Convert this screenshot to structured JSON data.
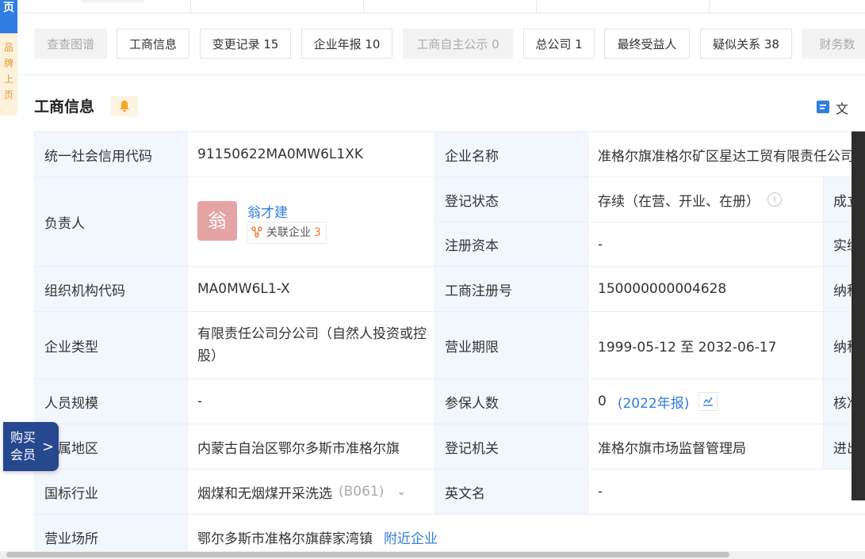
{
  "side_tab": {
    "cap": "页",
    "vertical_text": "品牌上页"
  },
  "filters": [
    {
      "label": "查查图谱",
      "disabled": true
    },
    {
      "label": "工商信息",
      "disabled": false
    },
    {
      "label": "变更记录 15",
      "disabled": false
    },
    {
      "label": "企业年报 10",
      "disabled": false
    },
    {
      "label": "工商自主公示 0",
      "disabled": true
    },
    {
      "label": "总公司 1",
      "disabled": false
    },
    {
      "label": "最终受益人",
      "disabled": false
    },
    {
      "label": "疑似关系 38",
      "disabled": false
    },
    {
      "label": "财务数",
      "disabled": true
    }
  ],
  "section": {
    "title": "工商信息",
    "doc_link": "文"
  },
  "labels": {
    "credit_code": "统一社会信用代码",
    "company_name": "企业名称",
    "legal_person": "负责人",
    "reg_status": "登记状态",
    "reg_capital": "注册资本",
    "org_code": "组织机构代码",
    "reg_no": "工商注册号",
    "company_type": "企业类型",
    "business_term": "营业期限",
    "staff_size": "人员规模",
    "insured": "参保人数",
    "region": "所属地区",
    "authority": "登记机关",
    "industry": "国标行业",
    "english_name": "英文名",
    "address": "营业场所",
    "right_1": "成立",
    "right_2": "实缴",
    "right_3": "纳税",
    "right_4": "纳税",
    "right_5": "核准",
    "right_6": "进出"
  },
  "values": {
    "credit_code": "91150622MA0MW6L1XK",
    "company_name": "准格尔旗准格尔矿区星达工贸有限责任公司",
    "person_avatar": "翁",
    "person_name": "翁才建",
    "related_label": "关联企业",
    "related_count": "3",
    "reg_status": "存续（在营、开业、在册）",
    "reg_capital": "-",
    "org_code": "MA0MW6L1-X",
    "reg_no": "150000000004628",
    "company_type": "有限责任公司分公司（自然人投资或控股）",
    "business_term": "1999-05-12 至 2032-06-17",
    "staff_size": "-",
    "insured_count": "0",
    "insured_report": "(2022年报)",
    "region": "内蒙古自治区鄂尔多斯市准格尔旗",
    "authority": "准格尔旗市场监督管理局",
    "industry": "烟煤和无烟煤开采洗选",
    "industry_code": "(B061)",
    "english_name": "-",
    "address": "鄂尔多斯市准格尔旗薛家湾镇",
    "nearby": "附近企业"
  },
  "vip": {
    "line1": "购买",
    "line2": "会员",
    "arrow": ">"
  },
  "colors": {
    "accent": "#2f7de1",
    "label_bg": "#f2f7fd",
    "vip_bg": "#27488f",
    "avatar_bg": "#e5a3a3",
    "count_orange": "#f07c2a"
  }
}
